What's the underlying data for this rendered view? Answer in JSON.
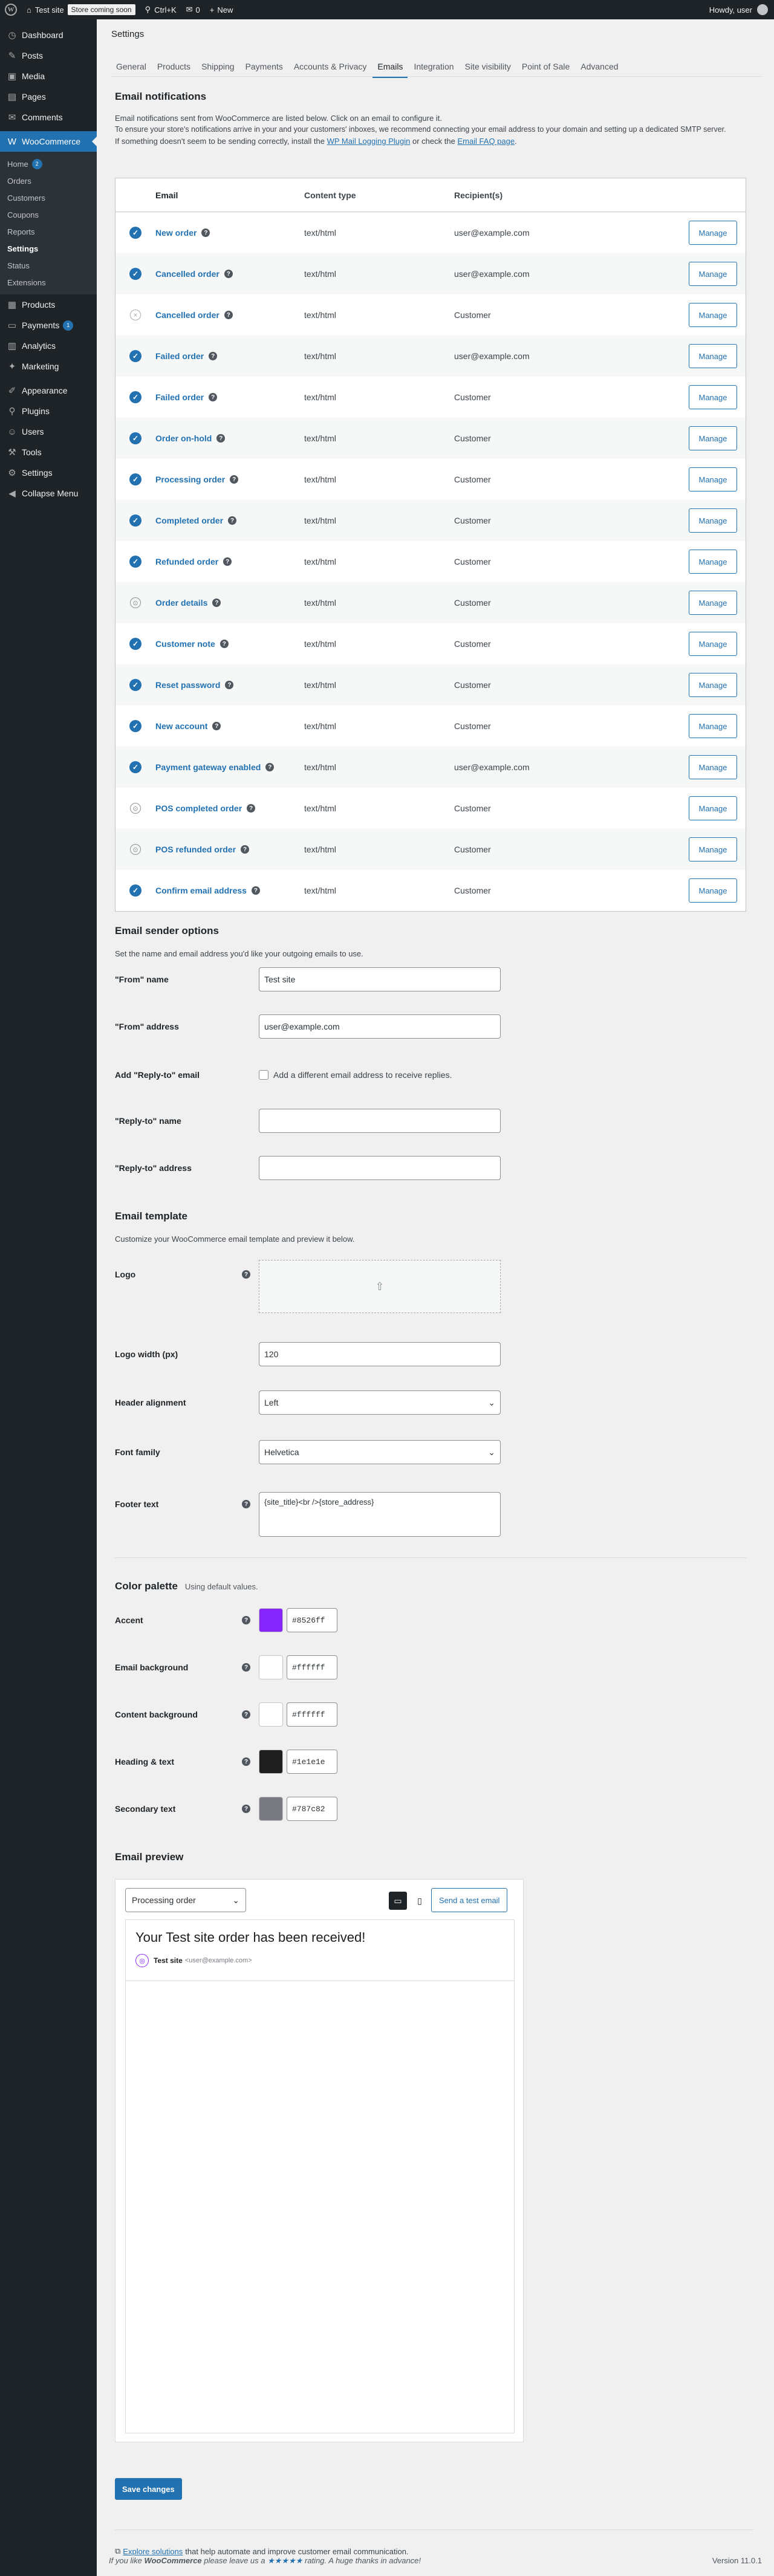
{
  "adminbar": {
    "site_name": "Test site",
    "coming_soon": "Store coming soon",
    "search_shortcut": "Ctrl+K",
    "comments_count": "0",
    "new_label": "New",
    "howdy": "Howdy, user"
  },
  "sidebar": {
    "items_top": [
      {
        "label": "Dashboard",
        "icon": "dashboard-icon",
        "glyph": "◷"
      },
      {
        "label": "Posts",
        "icon": "pin-icon",
        "glyph": "✎"
      },
      {
        "label": "Media",
        "icon": "media-icon",
        "glyph": "▣"
      },
      {
        "label": "Pages",
        "icon": "pages-icon",
        "glyph": "▤"
      },
      {
        "label": "Comments",
        "icon": "comments-icon",
        "glyph": "✉"
      }
    ],
    "woocommerce": {
      "label": "WooCommerce",
      "glyph": "W"
    },
    "sub": [
      {
        "label": "Home",
        "badge": "2"
      },
      {
        "label": "Orders"
      },
      {
        "label": "Customers"
      },
      {
        "label": "Coupons"
      },
      {
        "label": "Reports"
      },
      {
        "label": "Settings",
        "current": true
      },
      {
        "label": "Status"
      },
      {
        "label": "Extensions"
      }
    ],
    "items_mid": [
      {
        "label": "Products",
        "icon": "products-icon",
        "glyph": "▦"
      },
      {
        "label": "Payments",
        "icon": "payments-icon",
        "glyph": "▭",
        "badge": "1"
      },
      {
        "label": "Analytics",
        "icon": "analytics-icon",
        "glyph": "▥"
      },
      {
        "label": "Marketing",
        "icon": "marketing-icon",
        "glyph": "✦"
      }
    ],
    "items_bottom": [
      {
        "label": "Appearance",
        "icon": "appearance-icon",
        "glyph": "✐"
      },
      {
        "label": "Plugins",
        "icon": "plugins-icon",
        "glyph": "⚲"
      },
      {
        "label": "Users",
        "icon": "users-icon",
        "glyph": "☺"
      },
      {
        "label": "Tools",
        "icon": "tools-icon",
        "glyph": "⚒"
      },
      {
        "label": "Settings",
        "icon": "settings-icon",
        "glyph": "⚙"
      },
      {
        "label": "Collapse Menu",
        "icon": "collapse-icon",
        "glyph": "◀"
      }
    ]
  },
  "page": {
    "title": "Settings"
  },
  "tabs": [
    "General",
    "Products",
    "Shipping",
    "Payments",
    "Accounts & Privacy",
    "Emails",
    "Integration",
    "Site visibility",
    "Point of Sale",
    "Advanced"
  ],
  "active_tab": "Emails",
  "notifications": {
    "heading": "Email notifications",
    "desc1": "Email notifications sent from WooCommerce are listed below. Click on an email to configure it.",
    "desc2": "To ensure your store's notifications arrive in your and your customers' inboxes, we recommend connecting your email address to your domain and setting up a dedicated SMTP server.",
    "desc3a": "If something doesn't seem to be sending correctly, install the",
    "link1": "WP Mail Logging Plugin",
    "desc3b": "or check the",
    "link2": "Email FAQ page",
    "desc3c": ".",
    "headers": {
      "email": "Email",
      "type": "Content type",
      "recipients": "Recipient(s)"
    },
    "manage_label": "Manage",
    "rows": [
      {
        "status": "on",
        "name": "New order",
        "type": "text/html",
        "recipient": "user@example.com"
      },
      {
        "status": "on",
        "name": "Cancelled order",
        "type": "text/html",
        "recipient": "user@example.com"
      },
      {
        "status": "off",
        "name": "Cancelled order",
        "type": "text/html",
        "recipient": "Customer"
      },
      {
        "status": "on",
        "name": "Failed order",
        "type": "text/html",
        "recipient": "user@example.com"
      },
      {
        "status": "on",
        "name": "Failed order",
        "type": "text/html",
        "recipient": "Customer"
      },
      {
        "status": "on",
        "name": "Order on-hold",
        "type": "text/html",
        "recipient": "Customer"
      },
      {
        "status": "on",
        "name": "Processing order",
        "type": "text/html",
        "recipient": "Customer"
      },
      {
        "status": "on",
        "name": "Completed order",
        "type": "text/html",
        "recipient": "Customer"
      },
      {
        "status": "on",
        "name": "Refunded order",
        "type": "text/html",
        "recipient": "Customer"
      },
      {
        "status": "manual",
        "name": "Order details",
        "type": "text/html",
        "recipient": "Customer"
      },
      {
        "status": "on",
        "name": "Customer note",
        "type": "text/html",
        "recipient": "Customer"
      },
      {
        "status": "on",
        "name": "Reset password",
        "type": "text/html",
        "recipient": "Customer"
      },
      {
        "status": "on",
        "name": "New account",
        "type": "text/html",
        "recipient": "Customer"
      },
      {
        "status": "on",
        "name": "Payment gateway enabled",
        "type": "text/html",
        "recipient": "user@example.com"
      },
      {
        "status": "manual",
        "name": "POS completed order",
        "type": "text/html",
        "recipient": "Customer"
      },
      {
        "status": "manual",
        "name": "POS refunded order",
        "type": "text/html",
        "recipient": "Customer"
      },
      {
        "status": "on",
        "name": "Confirm email address",
        "type": "text/html",
        "recipient": "Customer"
      }
    ]
  },
  "sender": {
    "heading": "Email sender options",
    "desc": "Set the name and email address you'd like your outgoing emails to use.",
    "from_name_label": "\"From\" name",
    "from_name": "Test site",
    "from_address_label": "\"From\" address",
    "from_address": "user@example.com",
    "reply_label": "Add \"Reply-to\" email",
    "reply_cb": "Add a different email address to receive replies.",
    "reply_name_label": "\"Reply-to\" name",
    "reply_address_label": "\"Reply-to\" address"
  },
  "template": {
    "heading": "Email template",
    "desc": "Customize your WooCommerce email template and preview it below.",
    "logo_label": "Logo",
    "logo_width_label": "Logo width (px)",
    "logo_width": "120",
    "header_align_label": "Header alignment",
    "header_align": "Left",
    "font_label": "Font family",
    "font": "Helvetica",
    "footer_label": "Footer text",
    "footer": "{site_title}<br />{store_address}"
  },
  "palette": {
    "heading": "Color palette",
    "note": "Using default values.",
    "items": [
      {
        "label": "Accent",
        "hex": "#8526ff"
      },
      {
        "label": "Email background",
        "hex": "#ffffff"
      },
      {
        "label": "Content background",
        "hex": "#ffffff"
      },
      {
        "label": "Heading & text",
        "hex": "#1e1e1e"
      },
      {
        "label": "Secondary text",
        "hex": "#787c82"
      }
    ]
  },
  "preview": {
    "heading": "Email preview",
    "selected": "Processing order",
    "send_test": "Send a test email",
    "email_heading": "Your Test site order has been received!",
    "sender_name": "Test site",
    "sender_addr": "<user@example.com>"
  },
  "save_label": "Save changes",
  "explore": {
    "link": "Explore solutions",
    "text": "that help automate and improve customer email communication."
  },
  "footer": {
    "pre": "If you like",
    "brand": "WooCommerce",
    "mid": "please leave us a",
    "stars": "★★★★★",
    "post": "rating. A huge thanks in advance!"
  },
  "version": "Version 11.0.1"
}
